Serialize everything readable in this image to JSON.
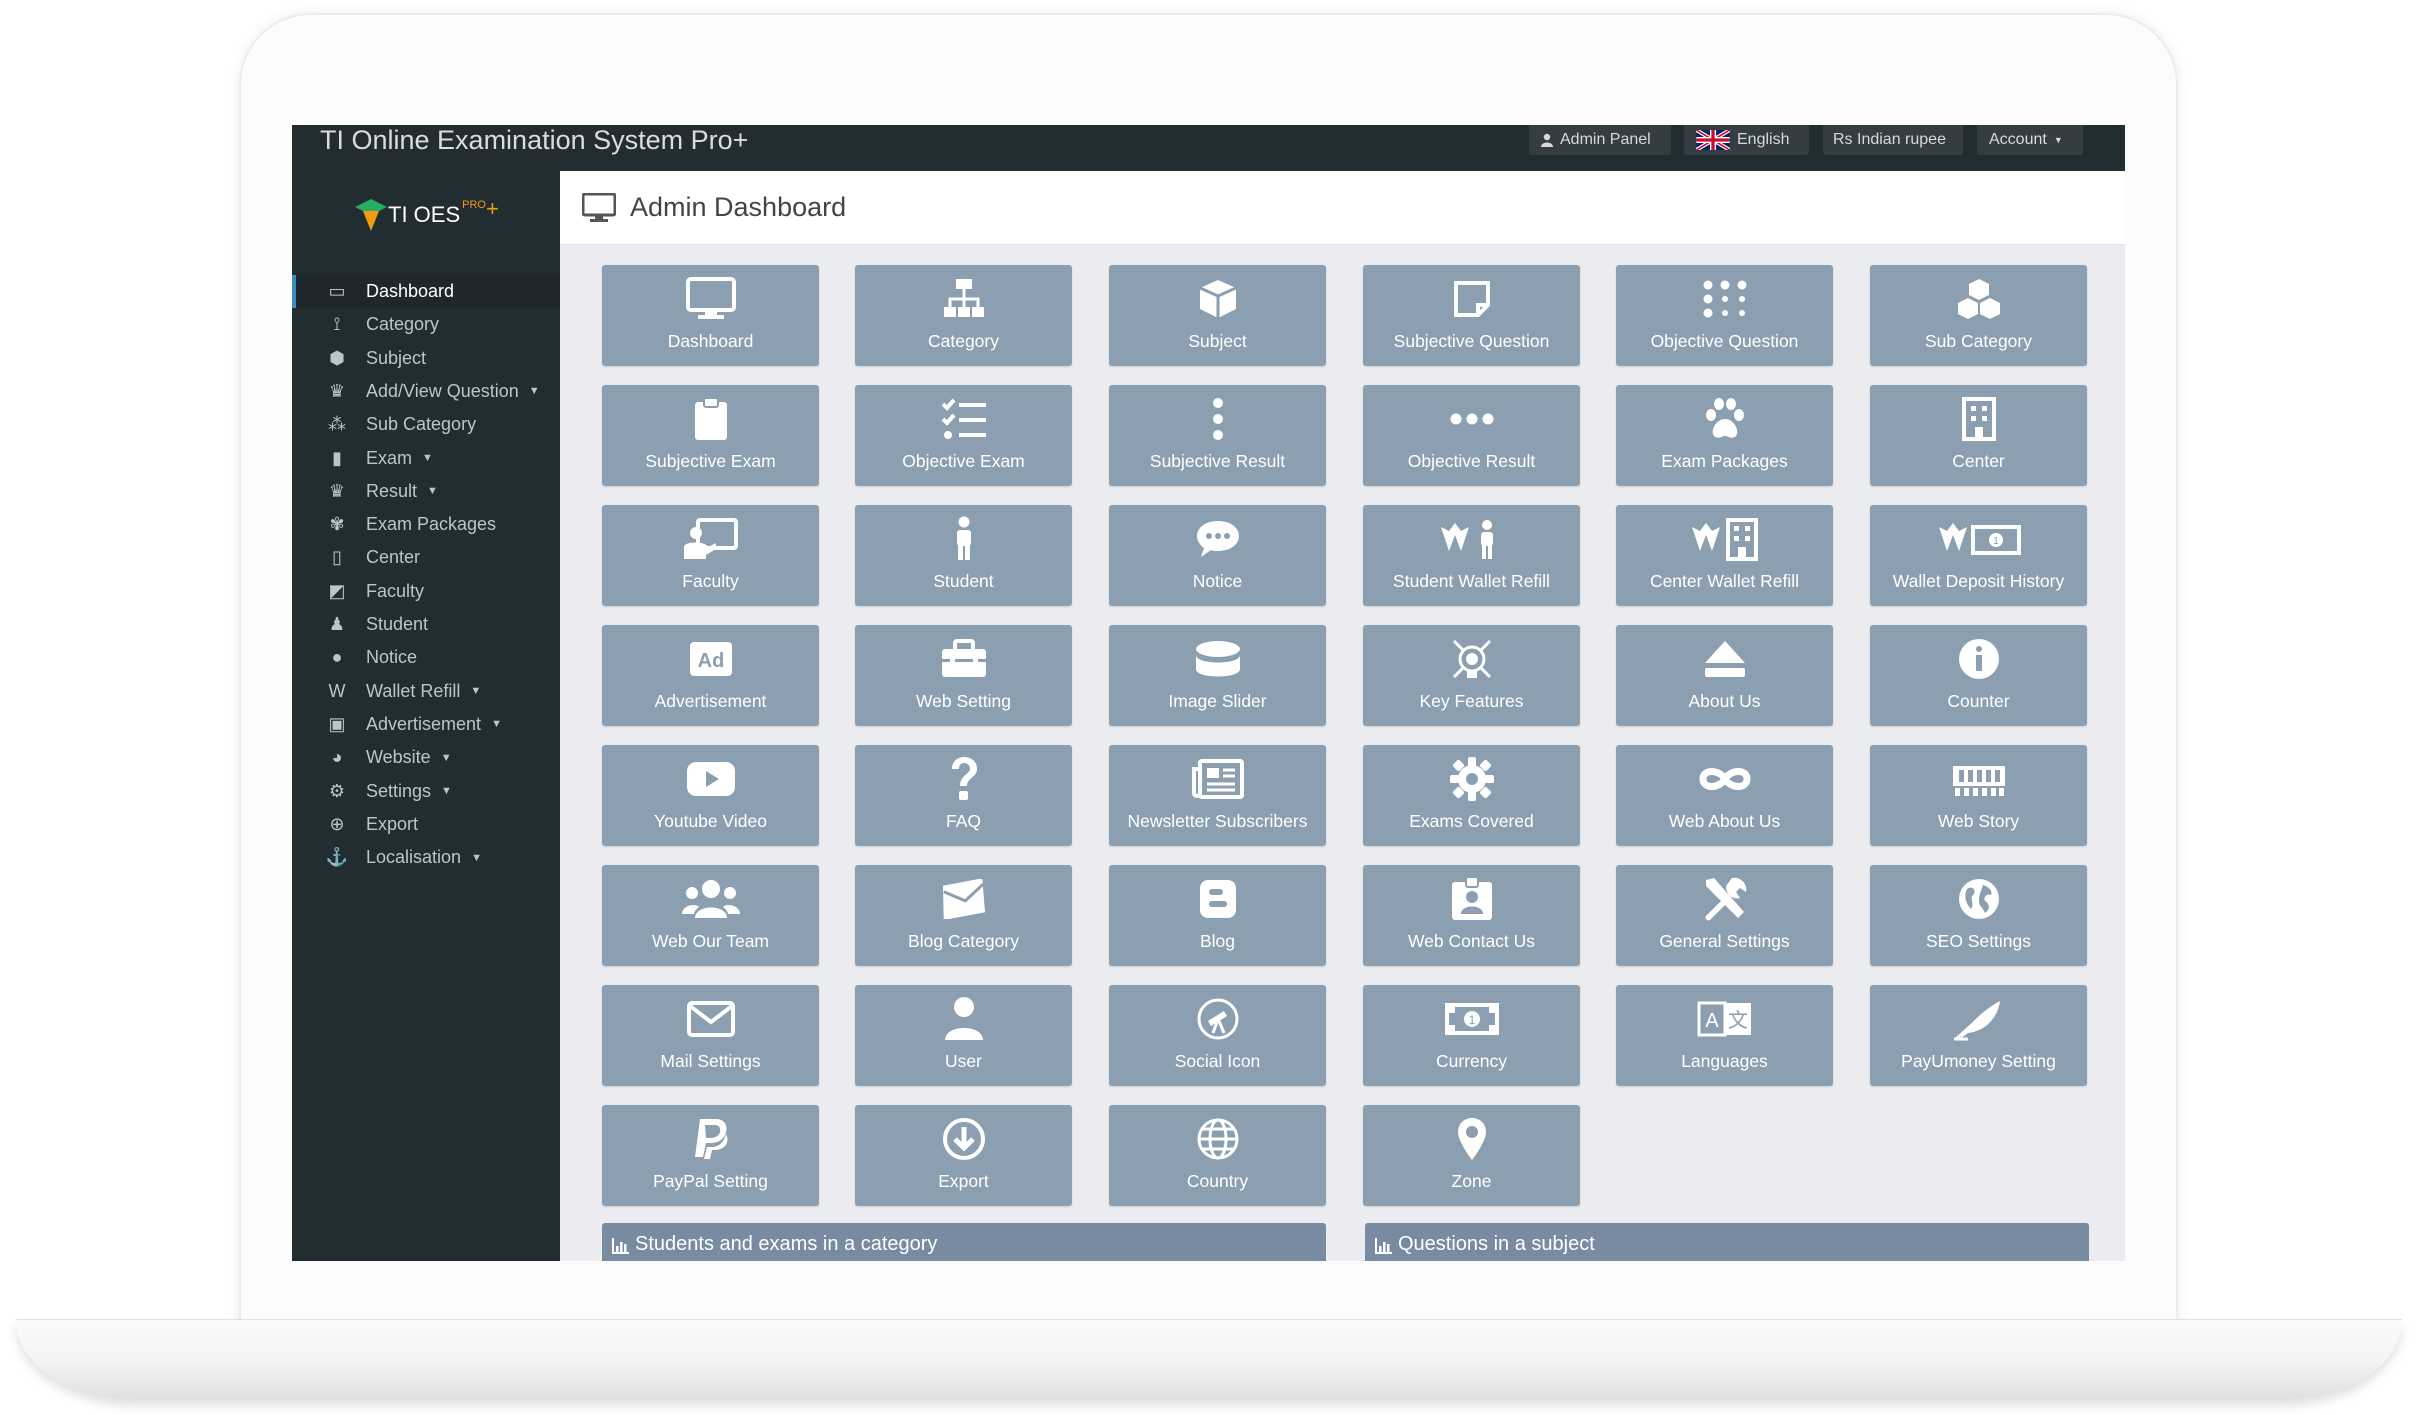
{
  "app_title": "TI Online Examination System Pro+",
  "topbar": {
    "admin_panel": "Admin Panel",
    "language": "English",
    "currency": "Rs Indian rupee",
    "account": "Account"
  },
  "logo": {
    "text": "TI OES",
    "pro": "PRO",
    "plus": "+"
  },
  "sidebar": {
    "items": [
      {
        "label": "Dashboard",
        "icon": "monitor-icon",
        "active": true
      },
      {
        "label": "Category",
        "icon": "sitemap-icon"
      },
      {
        "label": "Subject",
        "icon": "cube-icon"
      },
      {
        "label": "Add/View Question",
        "icon": "crown-icon",
        "dropdown": true
      },
      {
        "label": "Sub Category",
        "icon": "cubes-icon"
      },
      {
        "label": "Exam",
        "icon": "clipboard-icon",
        "dropdown": true
      },
      {
        "label": "Result",
        "icon": "trophy-icon",
        "dropdown": true
      },
      {
        "label": "Exam Packages",
        "icon": "paw-icon"
      },
      {
        "label": "Center",
        "icon": "building-icon"
      },
      {
        "label": "Faculty",
        "icon": "teacher-icon"
      },
      {
        "label": "Student",
        "icon": "person-icon"
      },
      {
        "label": "Notice",
        "icon": "comment-icon"
      },
      {
        "label": "Wallet Refill",
        "icon": "wallet-icon",
        "dropdown": true
      },
      {
        "label": "Advertisement",
        "icon": "image-icon",
        "dropdown": true
      },
      {
        "label": "Website",
        "icon": "globe-icon",
        "dropdown": true
      },
      {
        "label": "Settings",
        "icon": "gears-icon",
        "dropdown": true
      },
      {
        "label": "Export",
        "icon": "export-icon"
      },
      {
        "label": "Localisation",
        "icon": "anchor-icon",
        "dropdown": true
      }
    ]
  },
  "page_title": "Admin Dashboard",
  "tiles": [
    {
      "label": "Dashboard",
      "icon": "monitor-icon"
    },
    {
      "label": "Category",
      "icon": "sitemap-icon"
    },
    {
      "label": "Subject",
      "icon": "cube-icon"
    },
    {
      "label": "Subjective Question",
      "icon": "note-icon"
    },
    {
      "label": "Objective Question",
      "icon": "dots-grid-icon"
    },
    {
      "label": "Sub Category",
      "icon": "cubes-icon"
    },
    {
      "label": "Subjective Exam",
      "icon": "clipboard-icon"
    },
    {
      "label": "Objective Exam",
      "icon": "checklist-icon"
    },
    {
      "label": "Subjective Result",
      "icon": "vertical-ellipsis-icon"
    },
    {
      "label": "Objective Result",
      "icon": "horizontal-ellipsis-icon"
    },
    {
      "label": "Exam Packages",
      "icon": "paw-icon"
    },
    {
      "label": "Center",
      "icon": "building-icon"
    },
    {
      "label": "Faculty",
      "icon": "teacher-icon"
    },
    {
      "label": "Student",
      "icon": "person-icon"
    },
    {
      "label": "Notice",
      "icon": "comment-icon"
    },
    {
      "label": "Student Wallet Refill",
      "icon": "wallet-student-icon"
    },
    {
      "label": "Center Wallet Refill",
      "icon": "wallet-center-icon"
    },
    {
      "label": "Wallet Deposit History",
      "icon": "wallet-money-icon"
    },
    {
      "label": "Advertisement",
      "icon": "ad-icon"
    },
    {
      "label": "Web Setting",
      "icon": "toolbox-icon"
    },
    {
      "label": "Image Slider",
      "icon": "database-icon"
    },
    {
      "label": "Key Features",
      "icon": "satellite-icon"
    },
    {
      "label": "About Us",
      "icon": "eject-icon"
    },
    {
      "label": "Counter",
      "icon": "info-icon"
    },
    {
      "label": "Youtube Video",
      "icon": "youtube-icon"
    },
    {
      "label": "FAQ",
      "icon": "question-icon"
    },
    {
      "label": "Newsletter Subscribers",
      "icon": "newspaper-icon"
    },
    {
      "label": "Exams Covered",
      "icon": "gear-icon"
    },
    {
      "label": "Web About Us",
      "icon": "infinity-icon"
    },
    {
      "label": "Web Story",
      "icon": "memory-icon"
    },
    {
      "label": "Web Our Team",
      "icon": "users-icon"
    },
    {
      "label": "Blog Category",
      "icon": "envelope-open-icon"
    },
    {
      "label": "Blog",
      "icon": "blogger-icon"
    },
    {
      "label": "Web Contact Us",
      "icon": "id-badge-icon"
    },
    {
      "label": "General Settings",
      "icon": "tools-icon"
    },
    {
      "label": "SEO Settings",
      "icon": "globe-icon"
    },
    {
      "label": "Mail Settings",
      "icon": "envelope-icon"
    },
    {
      "label": "User",
      "icon": "user-icon"
    },
    {
      "label": "Social Icon",
      "icon": "telescope-icon"
    },
    {
      "label": "Currency",
      "icon": "money-bill-icon"
    },
    {
      "label": "Languages",
      "icon": "language-icon"
    },
    {
      "label": "PayUmoney Setting",
      "icon": "feather-icon"
    },
    {
      "label": "PayPal Setting",
      "icon": "paypal-icon"
    },
    {
      "label": "Export",
      "icon": "download-icon"
    },
    {
      "label": "Country",
      "icon": "globe-grid-icon"
    },
    {
      "label": "Zone",
      "icon": "map-marker-icon"
    }
  ],
  "panels": [
    {
      "title": "Students and exams in a category",
      "icon": "bar-chart-icon"
    },
    {
      "title": "Questions in a subject",
      "icon": "bar-chart-icon"
    }
  ],
  "colors": {
    "tile": "#8b9fb1",
    "sidebar": "#222d32",
    "panel_header": "#798ba0",
    "logo_accent": "#f39c12"
  }
}
